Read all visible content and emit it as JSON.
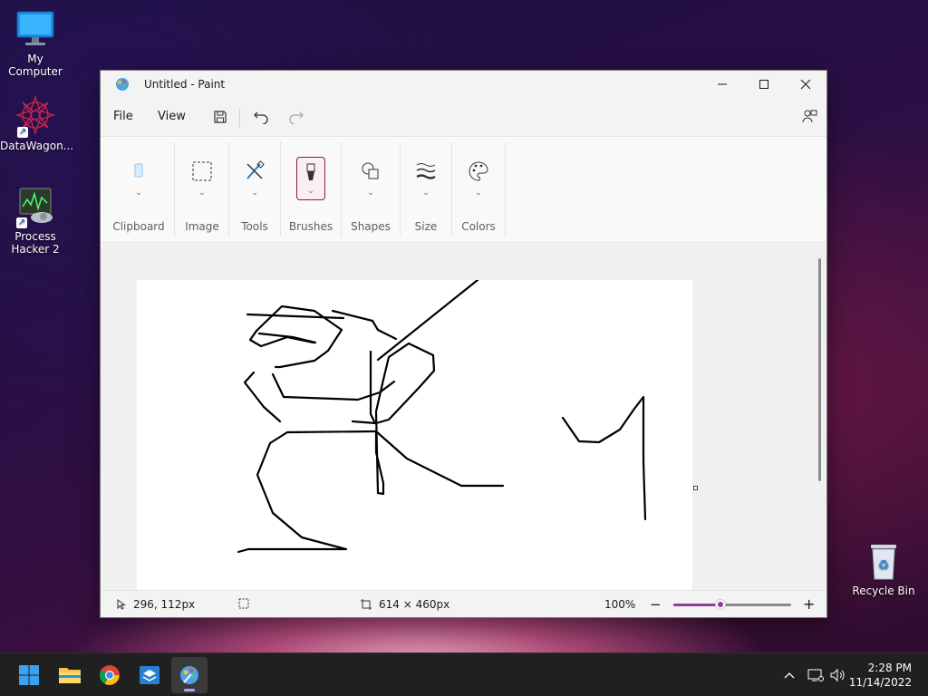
{
  "desktop": {
    "icons": [
      {
        "label": "My Computer"
      },
      {
        "label": "DataWagon..."
      },
      {
        "label": "Process\nHacker 2"
      },
      {
        "label": "Recycle Bin"
      }
    ]
  },
  "window": {
    "title": "Untitled - Paint",
    "menu": {
      "file": "File",
      "view": "View"
    },
    "ribbon": {
      "groups": [
        {
          "label": "Clipboard"
        },
        {
          "label": "Image"
        },
        {
          "label": "Tools"
        },
        {
          "label": "Brushes"
        },
        {
          "label": "Shapes"
        },
        {
          "label": "Size"
        },
        {
          "label": "Colors"
        }
      ]
    },
    "status": {
      "cursor_pos": "296, 112px",
      "canvas_size": "614 × 460px",
      "zoom_label": "100%",
      "zoom_level": 0.4
    }
  },
  "taskbar": {
    "apps": [
      "start-icon",
      "file-explorer-icon",
      "chrome-icon",
      "store-icon",
      "paint-icon"
    ],
    "clock": {
      "time": "2:28 PM",
      "date": "11/14/2022"
    }
  },
  "colors": {
    "accent": "#8e3a9e",
    "brush_highlight": "#8a1a4a"
  }
}
